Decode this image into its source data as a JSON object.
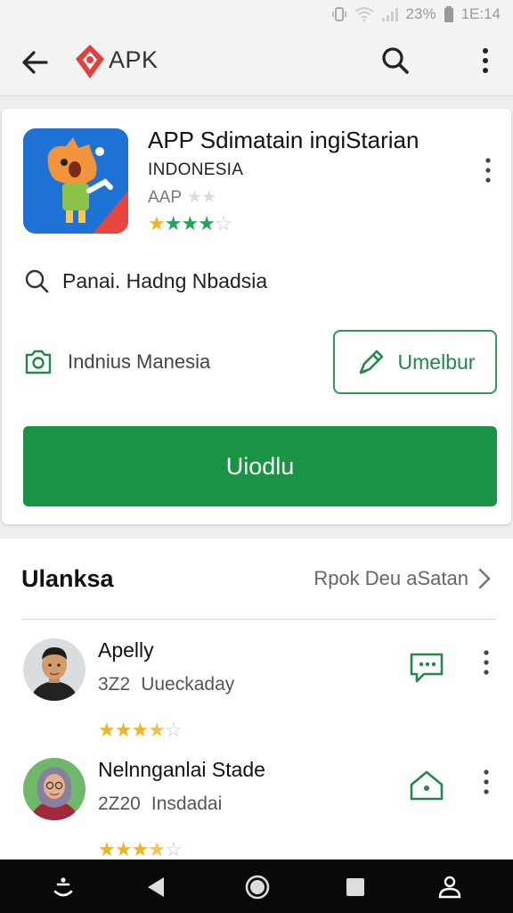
{
  "status_bar": {
    "battery": "23%",
    "time": "1E:14"
  },
  "app_bar": {
    "brand": "APK"
  },
  "app": {
    "title": "APP Sdimatain ingiStarian",
    "country": "INDONESIA",
    "sub_label": "AAP",
    "rating": 4,
    "icon_colors": {
      "bg": "#1e72d6",
      "accent": "#e8453c",
      "figure": "#f2953a"
    }
  },
  "search_row": {
    "text": "Panai. Hadng Nbadsia"
  },
  "camera_row": {
    "text": "Indnius Manesia"
  },
  "buttons": {
    "outline_label": "Umelbur",
    "primary_label": "Uiodlu"
  },
  "colors": {
    "primary": "#1a9444",
    "star": "#f0b323",
    "star_green": "#21a35a"
  },
  "reviews": {
    "title": "Ulanksa",
    "link": "Rpok Deu aSatan",
    "items": [
      {
        "name": "Apelly",
        "count": "3Z2",
        "date": "Uueckaday",
        "rating": 3.5,
        "action_icon": "chat-icon"
      },
      {
        "name": "Nelnnganlai Stade",
        "count": "2Z20",
        "date": "Insdadai",
        "rating": 3.5,
        "action_icon": "home-icon"
      }
    ]
  }
}
